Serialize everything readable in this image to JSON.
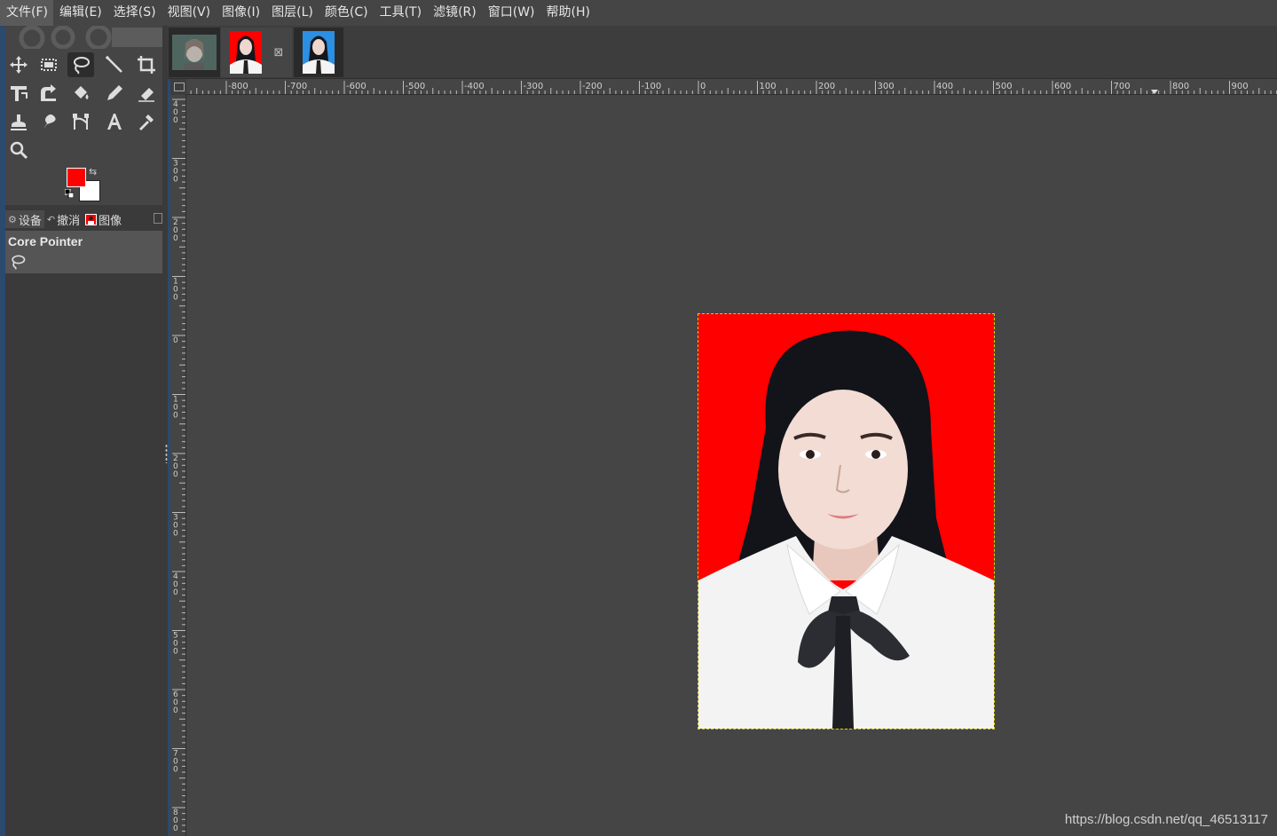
{
  "menu": [
    {
      "label": "文件(F)"
    },
    {
      "label": "编辑(E)"
    },
    {
      "label": "选择(S)"
    },
    {
      "label": "视图(V)"
    },
    {
      "label": "图像(I)"
    },
    {
      "label": "图层(L)"
    },
    {
      "label": "颜色(C)"
    },
    {
      "label": "工具(T)"
    },
    {
      "label": "滤镜(R)"
    },
    {
      "label": "窗口(W)"
    },
    {
      "label": "帮助(H)"
    }
  ],
  "toolbox": {
    "tools": [
      {
        "name": "move-tool-icon"
      },
      {
        "name": "rect-select-tool-icon"
      },
      {
        "name": "lasso-tool-icon",
        "active": true
      },
      {
        "name": "fuzzy-select-tool-icon"
      },
      {
        "name": "crop-tool-icon"
      },
      {
        "name": "transform-tool-icon"
      },
      {
        "name": "warp-tool-icon"
      },
      {
        "name": "bucket-fill-tool-icon"
      },
      {
        "name": "pencil-tool-icon"
      },
      {
        "name": "eraser-tool-icon"
      },
      {
        "name": "clone-tool-icon"
      },
      {
        "name": "smudge-tool-icon"
      },
      {
        "name": "paths-tool-icon"
      },
      {
        "name": "text-tool-icon"
      },
      {
        "name": "color-picker-tool-icon"
      },
      {
        "name": "zoom-tool-icon"
      }
    ],
    "foreground_color": "#ff0000",
    "background_color": "#ffffff"
  },
  "dock": {
    "tabs": [
      {
        "label": "设备",
        "icon": "device-icon"
      },
      {
        "label": "撤消",
        "icon": "undo-icon"
      },
      {
        "label": "图像",
        "icon": "image-icon"
      }
    ],
    "device_name": "Core Pointer"
  },
  "image_tabs": [
    {
      "name": "thumb-portrait-gray"
    },
    {
      "name": "thumb-portrait-red",
      "active": true,
      "close_glyph": "⊠"
    },
    {
      "name": "thumb-portrait-blue"
    }
  ],
  "rulers": {
    "horizontal_labels": [
      "-800",
      "-700",
      "-600",
      "-500",
      "-400",
      "-300",
      "-200",
      "-100",
      "0",
      "100",
      "200",
      "300",
      "400",
      "500",
      "600",
      "700",
      "800",
      "900"
    ],
    "vertical_labels": [
      "-400",
      "-300",
      "-200",
      "-100",
      "0",
      "100",
      "200",
      "300",
      "400",
      "500",
      "600",
      "700",
      "800"
    ]
  },
  "canvas": {
    "photo_background": "#ff0000",
    "selection_color": "#e0d000"
  },
  "watermark": "https://blog.csdn.net/qq_46513117"
}
